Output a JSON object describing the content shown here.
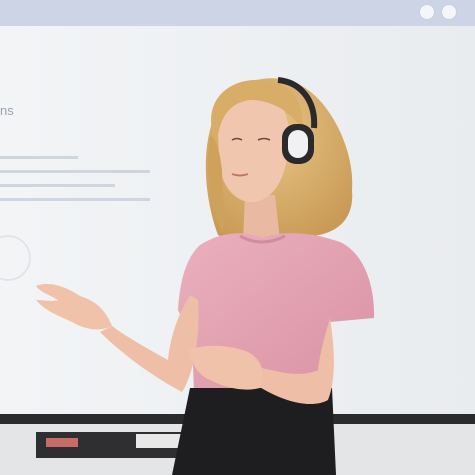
{
  "screen": {
    "title": "ns"
  },
  "colors": {
    "wall": "#e7e8ea",
    "screen_bg": "#eef0f3",
    "top_bar": "#cfd5e6",
    "bezel": "#2b2b2d",
    "shirt": "#e7a9b7",
    "skirt": "#1d1c1f",
    "hair": "#d9b06e",
    "skin": "#f0c4ad"
  }
}
